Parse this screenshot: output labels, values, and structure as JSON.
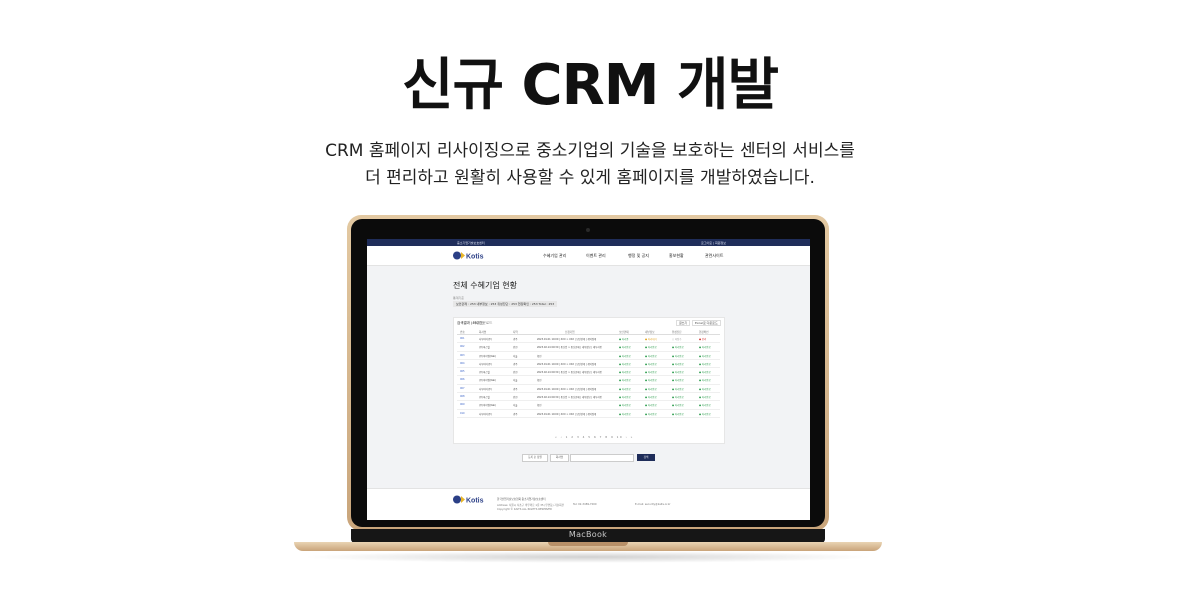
{
  "headline": "신규 CRM 개발",
  "description": {
    "line1": "CRM 홈페이지 리사이징으로 중소기업의 기술을 보호하는 센터의 서비스를",
    "line2": "더 편리하고 원활히 사용할 수 있게 홈페이지를 개발하였습니다."
  },
  "laptop": {
    "brand": "MacBook"
  },
  "screen": {
    "topbar": {
      "left": "중소기업기술보호센터",
      "right": "로그아웃 | 회원정보"
    },
    "logo_text": "Kotis",
    "nav": [
      "수혜기업 관리",
      "이벤트 관리",
      "행정 및 공지",
      "홍보현황",
      "관련사이트"
    ],
    "page_title": "전체 수혜기업 현황",
    "stats_label": "통계기준",
    "stats": "보안관제 : 253   내부정보 : 253   취성진단 : 253   현장확인 : 253   Total : 253",
    "panel": {
      "heading": "검색결과 (467건)",
      "sub": "엑셀다운로드",
      "btn_register": "글쓰기",
      "btn_excel": "Excel로 다운로드"
    },
    "table": {
      "headers": [
        "번호",
        "회사명",
        "지역",
        "신청기업",
        "보안관제",
        "내부정보",
        "취성진단",
        "현장확인"
      ],
      "rows": [
        {
          "no": "001",
          "company": "나무아이(주)",
          "region": "광주",
          "desc": "2023.01.01 10:00 | XXX > XXX | 보안관제 | 취약점제",
          "s1": "● 처리중",
          "s2": "● 처리대기",
          "s3": "○ 미접수",
          "s4": "● 반려"
        },
        {
          "no": "002",
          "company": "(주)파스텔",
          "region": "인천",
          "desc": "2023.02.14 09:30 | 통신업 > 통신판매 | 내부정보 | 세부사항",
          "s1": "● 처리완료",
          "s2": "● 처리완료",
          "s3": "● 처리완료",
          "s4": "● 처리완료"
        },
        {
          "no": "003",
          "company": "(주)아이랩(Ilab)",
          "region": "서울",
          "desc": "확인",
          "s1": "● 처리완료",
          "s2": "● 처리완료",
          "s3": "● 처리완료",
          "s4": "● 처리완료"
        },
        {
          "no": "004",
          "company": "나무아이(주)",
          "region": "광주",
          "desc": "2023.01.01 10:00 | XXX > XXX | 보안관제 | 취약점제",
          "s1": "● 처리완료",
          "s2": "● 처리완료",
          "s3": "● 처리완료",
          "s4": "● 처리완료"
        },
        {
          "no": "005",
          "company": "(주)파스텔",
          "region": "인천",
          "desc": "2023.02.14 09:30 | 통신업 > 통신판매 | 내부정보 | 세부사항",
          "s1": "● 처리완료",
          "s2": "● 처리완료",
          "s3": "● 처리완료",
          "s4": "● 처리완료"
        },
        {
          "no": "006",
          "company": "(주)아이랩(Ilab)",
          "region": "서울",
          "desc": "확인",
          "s1": "● 처리완료",
          "s2": "● 처리완료",
          "s3": "● 처리완료",
          "s4": "● 처리완료"
        },
        {
          "no": "007",
          "company": "나무아이(주)",
          "region": "광주",
          "desc": "2023.01.01 10:00 | XXX > XXX | 보안관제 | 취약점제",
          "s1": "● 처리완료",
          "s2": "● 처리완료",
          "s3": "● 처리완료",
          "s4": "● 처리완료"
        },
        {
          "no": "008",
          "company": "(주)파스텔",
          "region": "인천",
          "desc": "2023.02.14 09:30 | 통신업 > 통신판매 | 내부정보 | 세부사항",
          "s1": "● 처리완료",
          "s2": "● 처리완료",
          "s3": "● 처리완료",
          "s4": "● 처리완료"
        },
        {
          "no": "009",
          "company": "(주)아이랩(Ilab)",
          "region": "서울",
          "desc": "확인",
          "s1": "● 처리완료",
          "s2": "● 처리완료",
          "s3": "● 처리완료",
          "s4": "● 처리완료"
        },
        {
          "no": "010",
          "company": "나무아이(주)",
          "region": "광주",
          "desc": "2023.01.01 10:00 | XXX > XXX | 보안관제 | 취약점제",
          "s1": "● 처리완료",
          "s2": "● 처리완료",
          "s3": "● 처리완료",
          "s4": "● 처리완료"
        }
      ]
    },
    "pagination": "« ‹ 1 2 3 4 5 6 7 8 9 10 › »",
    "search": {
      "select1": "등록 순 정렬",
      "select2": "회사명",
      "button": "검색"
    },
    "footer": {
      "org": "한국산업기술보호협회  중소기업기술보호센터",
      "address": "Address: 서울시 서초구 바우뫼로 1길 35 (우면동) 기술회관",
      "tel": "Tel: 02-3489-7000",
      "email": "E-mail: security@kaits.or.kr",
      "copyright": "Copyright © KAITS ALL RIGHTS RESERVED"
    }
  }
}
